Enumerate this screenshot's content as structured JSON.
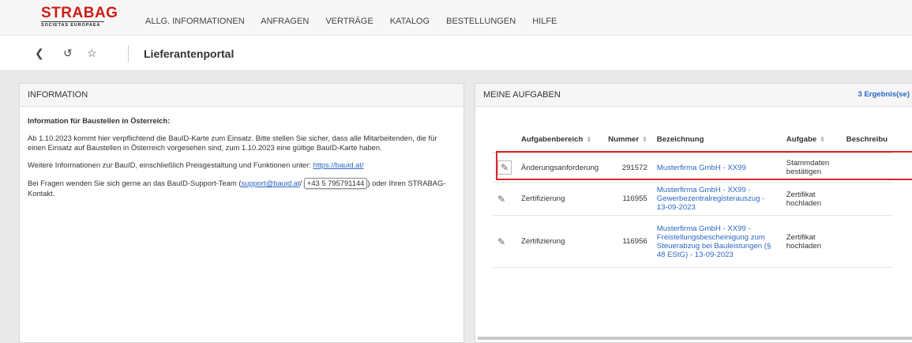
{
  "logo": {
    "main": "STRABAG",
    "sub": "SOCIETAS EUROPAEA"
  },
  "nav": [
    "ALLG. INFORMATIONEN",
    "ANFRAGEN",
    "VERTRÄGE",
    "KATALOG",
    "BESTELLUNGEN",
    "HILFE"
  ],
  "toolbar": {
    "back_icon": "chevron-left-icon",
    "history_icon": "history-icon",
    "star_icon": "star-outline-icon",
    "page_title": "Lieferantenportal"
  },
  "info": {
    "header": "INFORMATION",
    "title": "Information für Baustellen in Österreich:",
    "p1": "Ab 1.10.2023 kommt hier verpflichtend die BauID-Karte zum Einsatz. Bitte stellen Sie sicher, dass alle Mitarbeitenden, die für einen Einsatz auf Baustellen in Österreich vorgesehen sind, zum 1.10.2023 eine gültige BauID-Karte haben.",
    "p2_text": "Weitere Informationen zur BauID, einschließlich Preisgestaltung und Funktionen unter: ",
    "p2_link": "https://bauid.at/",
    "p3_text": "Bei Fragen wenden Sie sich gerne an das BauID-Support-Team (",
    "p3_link": "support@bauid.at",
    "p3_sep": "/",
    "p3_phone": "+43 5 795791144",
    "p3_end": ") oder Ihren STRABAG-Kontakt."
  },
  "tasks": {
    "header": "MEINE AUFGABEN",
    "results": "3 Ergebnis(se)",
    "columns": [
      "Aufgabenbereich",
      "Nummer",
      "Bezeichnung",
      "Aufgabe",
      "Beschreibu"
    ],
    "rows": [
      {
        "bereich": "Änderungsanforderung",
        "nummer": "291572",
        "bezeichnung": "Musterfirma GmbH - XX99",
        "aufgabe": "Stammdaten bestätigen"
      },
      {
        "bereich": "Zertifizierung",
        "nummer": "116955",
        "bezeichnung": "Musterfirma GmbH - XX99 - Gewerbezentralregisterauszug - 13-09-2023",
        "aufgabe": "Zertifikat hochladen"
      },
      {
        "bereich": "Zertifizierung",
        "nummer": "116956",
        "bezeichnung": "Musterfirma GmbH - XX99 - Freistellungsbescheinigung zum Steuerabzug bei Bauleistungen (§ 48 EStG) - 13-09-2023",
        "aufgabe": "Zertifikat hochladen"
      }
    ]
  }
}
